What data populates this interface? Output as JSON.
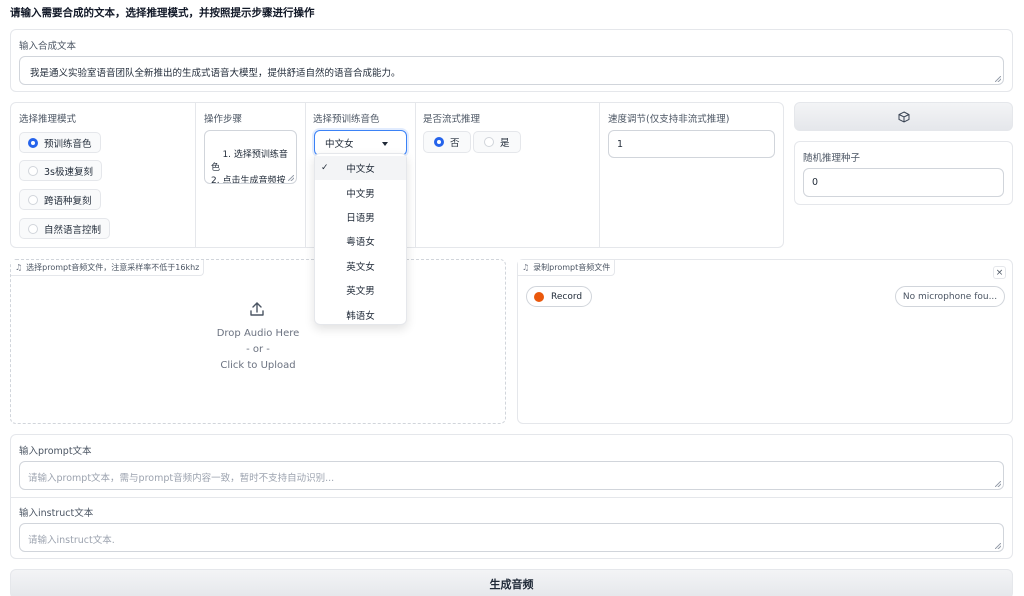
{
  "header": {
    "title": "请输入需要合成的文本，选择推理模式，并按照提示步骤进行操作"
  },
  "tts_text": {
    "label": "输入合成文本",
    "value": "我是通义实验室语音团队全新推出的生成式语音大模型，提供舒适自然的语音合成能力。"
  },
  "mode": {
    "label": "选择推理模式",
    "options": [
      "预训练音色",
      "3s极速复刻",
      "跨语种复刻",
      "自然语言控制"
    ],
    "selected": "预训练音色"
  },
  "steps": {
    "label": "操作步骤",
    "value": "1. 选择预训练音色\n2. 点击生成音频按钮"
  },
  "voice": {
    "label": "选择预训练音色",
    "value": "中文女",
    "options": [
      "中文女",
      "中文男",
      "日语男",
      "粤语女",
      "英文女",
      "英文男",
      "韩语女"
    ],
    "check": "✓"
  },
  "stream": {
    "label": "是否流式推理",
    "options": [
      "否",
      "是"
    ],
    "selected": "否"
  },
  "speed": {
    "label": "速度调节(仅支持非流式推理)",
    "value": "1"
  },
  "seed": {
    "label": "随机推理种子",
    "value": "0",
    "dice_icon": "dice-icon"
  },
  "upload": {
    "tag": "选择prompt音频文件，注意采样率不低于16khz",
    "drop": "Drop Audio Here",
    "or": "- or -",
    "click": "Click to Upload"
  },
  "record": {
    "tag": "录制prompt音频文件",
    "record_label": "Record",
    "mic_label": "No microphone fou...",
    "close": "×"
  },
  "prompt_text": {
    "label": "输入prompt文本",
    "placeholder": "请输入prompt文本，需与prompt音频内容一致，暂时不支持自动识别..."
  },
  "instruct_text": {
    "label": "输入instruct文本",
    "placeholder": "请输入instruct文本."
  },
  "generate": {
    "label": "生成音频"
  },
  "colors": {
    "accent": "#2563eb",
    "record": "#ea580c"
  }
}
